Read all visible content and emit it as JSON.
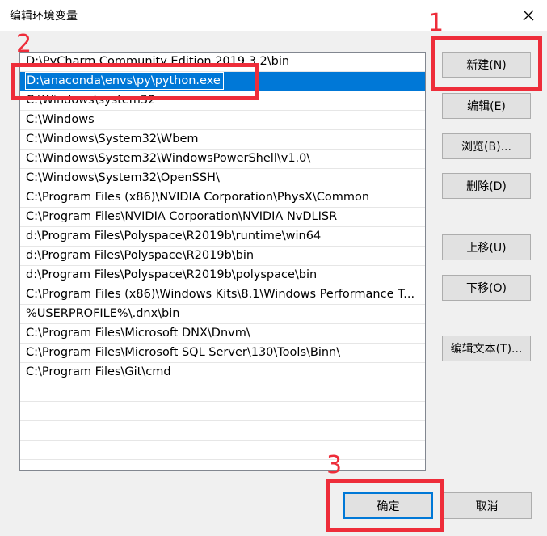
{
  "window": {
    "title": "编辑环境变量"
  },
  "path_list": [
    "D:\\PyCharm Community Edition 2019.3.2\\bin",
    "D:\\anaconda\\envs\\py\\python.exe",
    "C:\\Windows\\system32",
    "C:\\Windows",
    "C:\\Windows\\System32\\Wbem",
    "C:\\Windows\\System32\\WindowsPowerShell\\v1.0\\",
    "C:\\Windows\\System32\\OpenSSH\\",
    "C:\\Program Files (x86)\\NVIDIA Corporation\\PhysX\\Common",
    "C:\\Program Files\\NVIDIA Corporation\\NVIDIA NvDLISR",
    "d:\\Program Files\\Polyspace\\R2019b\\runtime\\win64",
    "d:\\Program Files\\Polyspace\\R2019b\\bin",
    "d:\\Program Files\\Polyspace\\R2019b\\polyspace\\bin",
    "C:\\Program Files (x86)\\Windows Kits\\8.1\\Windows Performance T...",
    "%USERPROFILE%\\.dnx\\bin",
    "C:\\Program Files\\Microsoft DNX\\Dnvm\\",
    "C:\\Program Files\\Microsoft SQL Server\\130\\Tools\\Binn\\",
    "C:\\Program Files\\Git\\cmd"
  ],
  "buttons": {
    "new": "新建(N)",
    "edit": "编辑(E)",
    "browse": "浏览(B)...",
    "delete": "删除(D)",
    "move_up": "上移(U)",
    "move_down": "下移(O)",
    "edit_text": "编辑文本(T)...",
    "ok": "确定",
    "cancel": "取消"
  },
  "annotations": {
    "step1": "1",
    "step2": "2",
    "step3": "3"
  },
  "colors": {
    "selection": "#0078d7",
    "annotation": "#ee2d3a"
  }
}
